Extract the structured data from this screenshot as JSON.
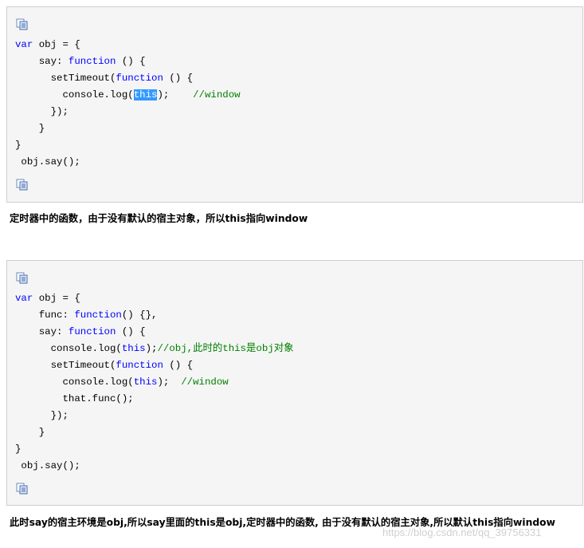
{
  "colors": {
    "keyword": "#0000ff",
    "comment": "#008000",
    "selection_bg": "#3399ff",
    "code_bg": "#f5f5f5",
    "code_border": "#cfcfcf"
  },
  "icons": {
    "copy": "copy-code-icon"
  },
  "block1": {
    "l1a": "var",
    "l1b": " obj = {",
    "l2a": "    say: ",
    "l2b": "function",
    "l2c": " () {",
    "l3a": "      setTimeout(",
    "l3b": "function",
    "l3c": " () {",
    "l4a": "        console.log(",
    "l4b": "this",
    "l4c": ");    ",
    "l4d": "//window",
    "l5": "      });",
    "l6": "    }",
    "l7": "}",
    "l8": " obj.say();"
  },
  "explain1": "定时器中的函数，由于没有默认的宿主对象，所以this指向window",
  "block2": {
    "l1a": "var",
    "l1b": " obj = {",
    "l2a": "    func: ",
    "l2b": "function",
    "l2c": "() {},",
    "l3a": "    say: ",
    "l3b": "function",
    "l3c": " () {",
    "l4a": "      console.log(",
    "l4b": "this",
    "l4c": ");",
    "l4d": "//obj,此时的this是obj对象",
    "l5a": "      setTimeout(",
    "l5b": "function",
    "l5c": " () {",
    "l6a": "        console.log(",
    "l6b": "this",
    "l6c": ");  ",
    "l6d": "//window",
    "l7": "        that.func();",
    "l8": "      });",
    "l9": "    }",
    "l10": "}",
    "l11": " obj.say();"
  },
  "explain2": "此时say的宿主环境是obj,所以say里面的this是obj,定时器中的函数, 由于没有默认的宿主对象,所以默认this指向window",
  "watermark": "https://blog.csdn.net/qq_39756331"
}
